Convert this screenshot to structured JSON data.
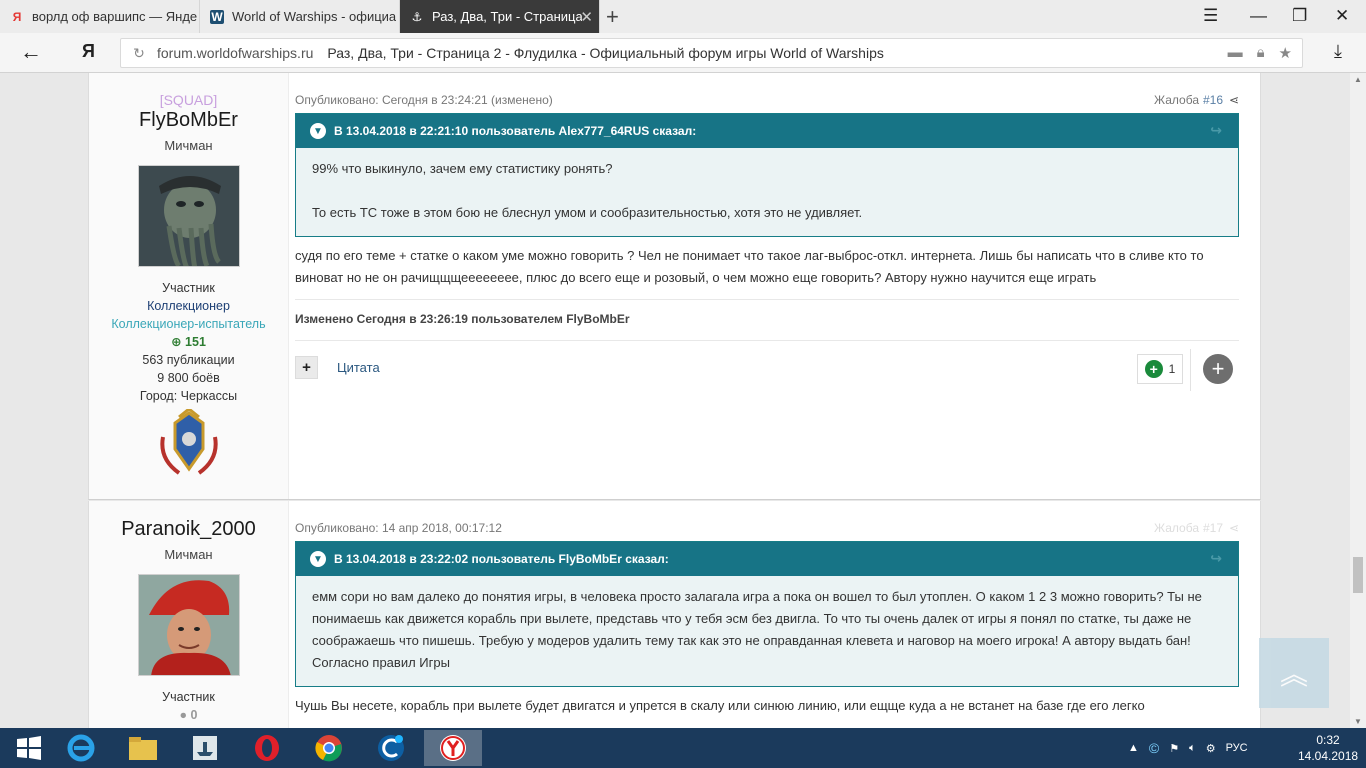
{
  "browser": {
    "tabs": [
      {
        "title": "ворлд оф варшипс — Янде",
        "icon": "Я",
        "active": false
      },
      {
        "title": "World of Warships - официа",
        "icon": "W",
        "active": false
      },
      {
        "title": "Раз, Два, Три - Страница",
        "icon": "⚓",
        "active": true
      }
    ],
    "address": {
      "domain": "forum.worldofwarships.ru",
      "page_title": "Раз, Два, Три - Страница 2 - Флудилка - Официальный форум игры World of Warships"
    },
    "ya_label": "Я"
  },
  "posts": [
    {
      "squad": "[SQUAD]",
      "username": "FlyBoMbEr",
      "rank": "Мичман",
      "group": "Участник",
      "title1": "Коллекционер",
      "title2": "Коллекционер-испытатель",
      "reputation": "151",
      "publications": "563 публикации",
      "battles": "9 800 боёв",
      "city": "Город: Черкассы",
      "published": "Опубликовано: Сегодня в 23:24:21 (изменено)",
      "report": "Жалоба",
      "number": "#16",
      "quote_header": "В 13.04.2018 в 22:21:10 пользователь Alex777_64RUS сказал:",
      "quote_lines": [
        "99% что выкинуло, зачем ему статистику ронять?",
        "То есть ТС тоже в этом бою не блеснул умом и сообразительностью, хотя это не удивляет."
      ],
      "text": "судя по его теме + статке о каком уме можно говорить ? Чел не понимает что такое лаг-выброс-откл. интернета. Лишь бы написать что в сливе кто то виноват но не он рачищщщееееееее, плюс до всего еще и розовый, о чем можно еще говорить? Автору нужно научится еще играть",
      "edited": "Изменено Сегодня в 23:26:19 пользователем FlyBoMbEr",
      "quote_btn": "Цитата",
      "likes": "1"
    },
    {
      "username": "Paranoik_2000",
      "rank": "Мичман",
      "group": "Участник",
      "reputation": "0",
      "published": "Опубликовано: 14 апр 2018, 00:17:12",
      "report": "Жалоба",
      "number": "#17",
      "quote_header": "В 13.04.2018 в 23:22:02 пользователь FlyBoMbEr сказал:",
      "quote_text": "емм сори но вам далеко до понятия игры, в человека просто залагала игра а пока он вошел то был утоплен. О каком 1 2 3 можно говорить? Ты не понимаешь как движется корабль при вылете, представь что у тебя эсм без двигла. То что ты очень далек от игры я понял по статке, ты даже не соображаешь что пишешь. Требую у модеров удалить тему так как это не оправданная клевета и наговор на моего игрока! А автору выдать бан! Согласно правил Игры",
      "text": "Чушь Вы несете, корабль при вылете будет двигатся и упрется в скалу или синюю линию, или ещще куда а не встанет на базе где его легко"
    }
  ],
  "taskbar": {
    "lang": "РУС",
    "time": "0:32",
    "date": "14.04.2018"
  },
  "colors": {
    "quote_header": "#177486",
    "quote_bg": "#ebf3f4",
    "rep_green": "#1a8a3b",
    "taskbar": "#1b3a5c"
  }
}
